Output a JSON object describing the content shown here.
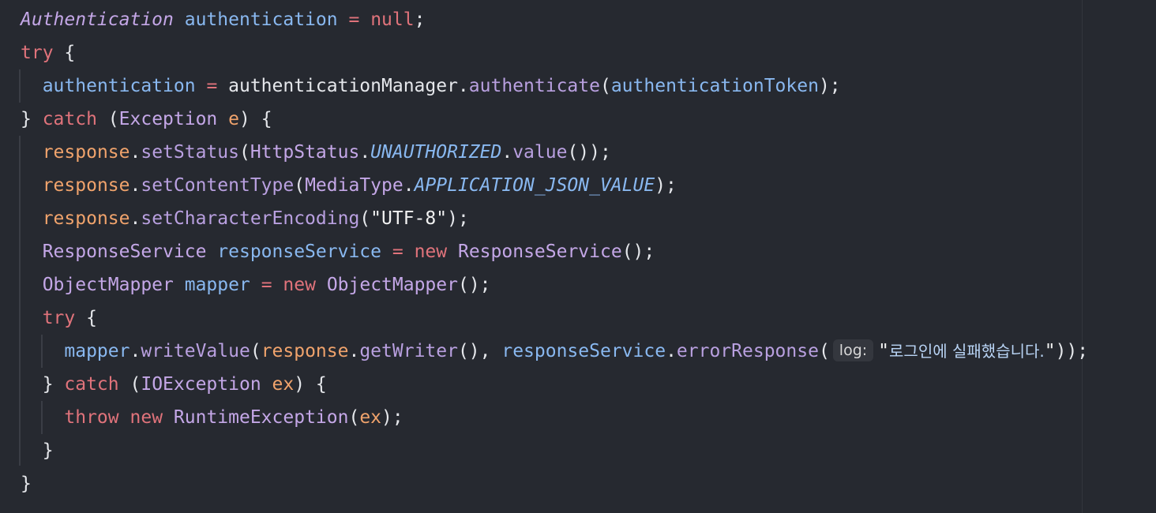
{
  "editor": {
    "lines": [
      {
        "tokens": [
          {
            "t": "Authentication",
            "c": "italic-type"
          },
          {
            "t": " ",
            "c": "plain"
          },
          {
            "t": "authentication",
            "c": "var"
          },
          {
            "t": " ",
            "c": "plain"
          },
          {
            "t": "=",
            "c": "kw"
          },
          {
            "t": " ",
            "c": "plain"
          },
          {
            "t": "null",
            "c": "kw"
          },
          {
            "t": ";",
            "c": "plain"
          }
        ]
      },
      {
        "tokens": [
          {
            "t": "try",
            "c": "kw"
          },
          {
            "t": " {",
            "c": "plain"
          }
        ]
      },
      {
        "tokens": [
          {
            "t": "  ",
            "c": "plain"
          },
          {
            "t": "authentication",
            "c": "var"
          },
          {
            "t": " ",
            "c": "plain"
          },
          {
            "t": "=",
            "c": "kw"
          },
          {
            "t": " authenticationManager.",
            "c": "plain"
          },
          {
            "t": "authenticate",
            "c": "meth"
          },
          {
            "t": "(",
            "c": "plain"
          },
          {
            "t": "authenticationToken",
            "c": "var"
          },
          {
            "t": ");",
            "c": "plain"
          }
        ]
      },
      {
        "tokens": [
          {
            "t": "} ",
            "c": "plain"
          },
          {
            "t": "catch",
            "c": "kw"
          },
          {
            "t": " (",
            "c": "plain"
          },
          {
            "t": "Exception",
            "c": "type"
          },
          {
            "t": " ",
            "c": "plain"
          },
          {
            "t": "e",
            "c": "param"
          },
          {
            "t": ") {",
            "c": "plain"
          }
        ]
      },
      {
        "tokens": [
          {
            "t": "  ",
            "c": "plain"
          },
          {
            "t": "response",
            "c": "param"
          },
          {
            "t": ".",
            "c": "plain"
          },
          {
            "t": "setStatus",
            "c": "meth"
          },
          {
            "t": "(",
            "c": "plain"
          },
          {
            "t": "HttpStatus",
            "c": "type"
          },
          {
            "t": ".",
            "c": "plain"
          },
          {
            "t": "UNAUTHORIZED",
            "c": "const"
          },
          {
            "t": ".",
            "c": "plain"
          },
          {
            "t": "value",
            "c": "meth"
          },
          {
            "t": "());",
            "c": "plain"
          }
        ]
      },
      {
        "tokens": [
          {
            "t": "  ",
            "c": "plain"
          },
          {
            "t": "response",
            "c": "param"
          },
          {
            "t": ".",
            "c": "plain"
          },
          {
            "t": "setContentType",
            "c": "meth"
          },
          {
            "t": "(",
            "c": "plain"
          },
          {
            "t": "MediaType",
            "c": "type"
          },
          {
            "t": ".",
            "c": "plain"
          },
          {
            "t": "APPLICATION_JSON_VALUE",
            "c": "const"
          },
          {
            "t": ");",
            "c": "plain"
          }
        ]
      },
      {
        "tokens": [
          {
            "t": "  ",
            "c": "plain"
          },
          {
            "t": "response",
            "c": "param"
          },
          {
            "t": ".",
            "c": "plain"
          },
          {
            "t": "setCharacterEncoding",
            "c": "meth"
          },
          {
            "t": "(",
            "c": "plain"
          },
          {
            "t": "\"UTF-8\"",
            "c": "str"
          },
          {
            "t": ");",
            "c": "plain"
          }
        ]
      },
      {
        "tokens": [
          {
            "t": "  ",
            "c": "plain"
          },
          {
            "t": "ResponseService",
            "c": "type"
          },
          {
            "t": " ",
            "c": "plain"
          },
          {
            "t": "responseService",
            "c": "var"
          },
          {
            "t": " ",
            "c": "plain"
          },
          {
            "t": "=",
            "c": "kw"
          },
          {
            "t": " ",
            "c": "plain"
          },
          {
            "t": "new",
            "c": "kw"
          },
          {
            "t": " ",
            "c": "plain"
          },
          {
            "t": "ResponseService",
            "c": "type"
          },
          {
            "t": "();",
            "c": "plain"
          }
        ]
      },
      {
        "tokens": [
          {
            "t": "  ",
            "c": "plain"
          },
          {
            "t": "ObjectMapper",
            "c": "type"
          },
          {
            "t": " ",
            "c": "plain"
          },
          {
            "t": "mapper",
            "c": "var"
          },
          {
            "t": " ",
            "c": "plain"
          },
          {
            "t": "=",
            "c": "kw"
          },
          {
            "t": " ",
            "c": "plain"
          },
          {
            "t": "new",
            "c": "kw"
          },
          {
            "t": " ",
            "c": "plain"
          },
          {
            "t": "ObjectMapper",
            "c": "type"
          },
          {
            "t": "();",
            "c": "plain"
          }
        ]
      },
      {
        "tokens": [
          {
            "t": "  ",
            "c": "plain"
          },
          {
            "t": "try",
            "c": "kw"
          },
          {
            "t": " {",
            "c": "plain"
          }
        ]
      },
      {
        "tokens": [
          {
            "t": "    ",
            "c": "plain"
          },
          {
            "t": "mapper",
            "c": "var"
          },
          {
            "t": ".",
            "c": "plain"
          },
          {
            "t": "writeValue",
            "c": "meth"
          },
          {
            "t": "(",
            "c": "plain"
          },
          {
            "t": "response",
            "c": "param"
          },
          {
            "t": ".",
            "c": "plain"
          },
          {
            "t": "getWriter",
            "c": "meth"
          },
          {
            "t": "(), ",
            "c": "plain"
          },
          {
            "t": "responseService",
            "c": "var"
          },
          {
            "t": ".",
            "c": "plain"
          },
          {
            "t": "errorResponse",
            "c": "meth"
          },
          {
            "t": "(",
            "c": "plain"
          },
          {
            "t": "log:",
            "c": "hint"
          },
          {
            "t": "\"",
            "c": "str"
          },
          {
            "t": "로그인에 실패했습니다.",
            "c": "korean"
          },
          {
            "t": "\"",
            "c": "str"
          },
          {
            "t": "));",
            "c": "plain"
          }
        ]
      },
      {
        "tokens": [
          {
            "t": "  } ",
            "c": "plain"
          },
          {
            "t": "catch",
            "c": "kw"
          },
          {
            "t": " (",
            "c": "plain"
          },
          {
            "t": "IOException",
            "c": "type"
          },
          {
            "t": " ",
            "c": "plain"
          },
          {
            "t": "ex",
            "c": "param"
          },
          {
            "t": ") {",
            "c": "plain"
          }
        ]
      },
      {
        "tokens": [
          {
            "t": "    ",
            "c": "plain"
          },
          {
            "t": "throw",
            "c": "kw"
          },
          {
            "t": " ",
            "c": "plain"
          },
          {
            "t": "new",
            "c": "kw"
          },
          {
            "t": " ",
            "c": "plain"
          },
          {
            "t": "RuntimeException",
            "c": "type"
          },
          {
            "t": "(",
            "c": "plain"
          },
          {
            "t": "ex",
            "c": "param"
          },
          {
            "t": ");",
            "c": "plain"
          }
        ]
      },
      {
        "tokens": [
          {
            "t": "  }",
            "c": "plain"
          }
        ]
      },
      {
        "tokens": [
          {
            "t": "}",
            "c": "plain"
          }
        ]
      }
    ]
  }
}
